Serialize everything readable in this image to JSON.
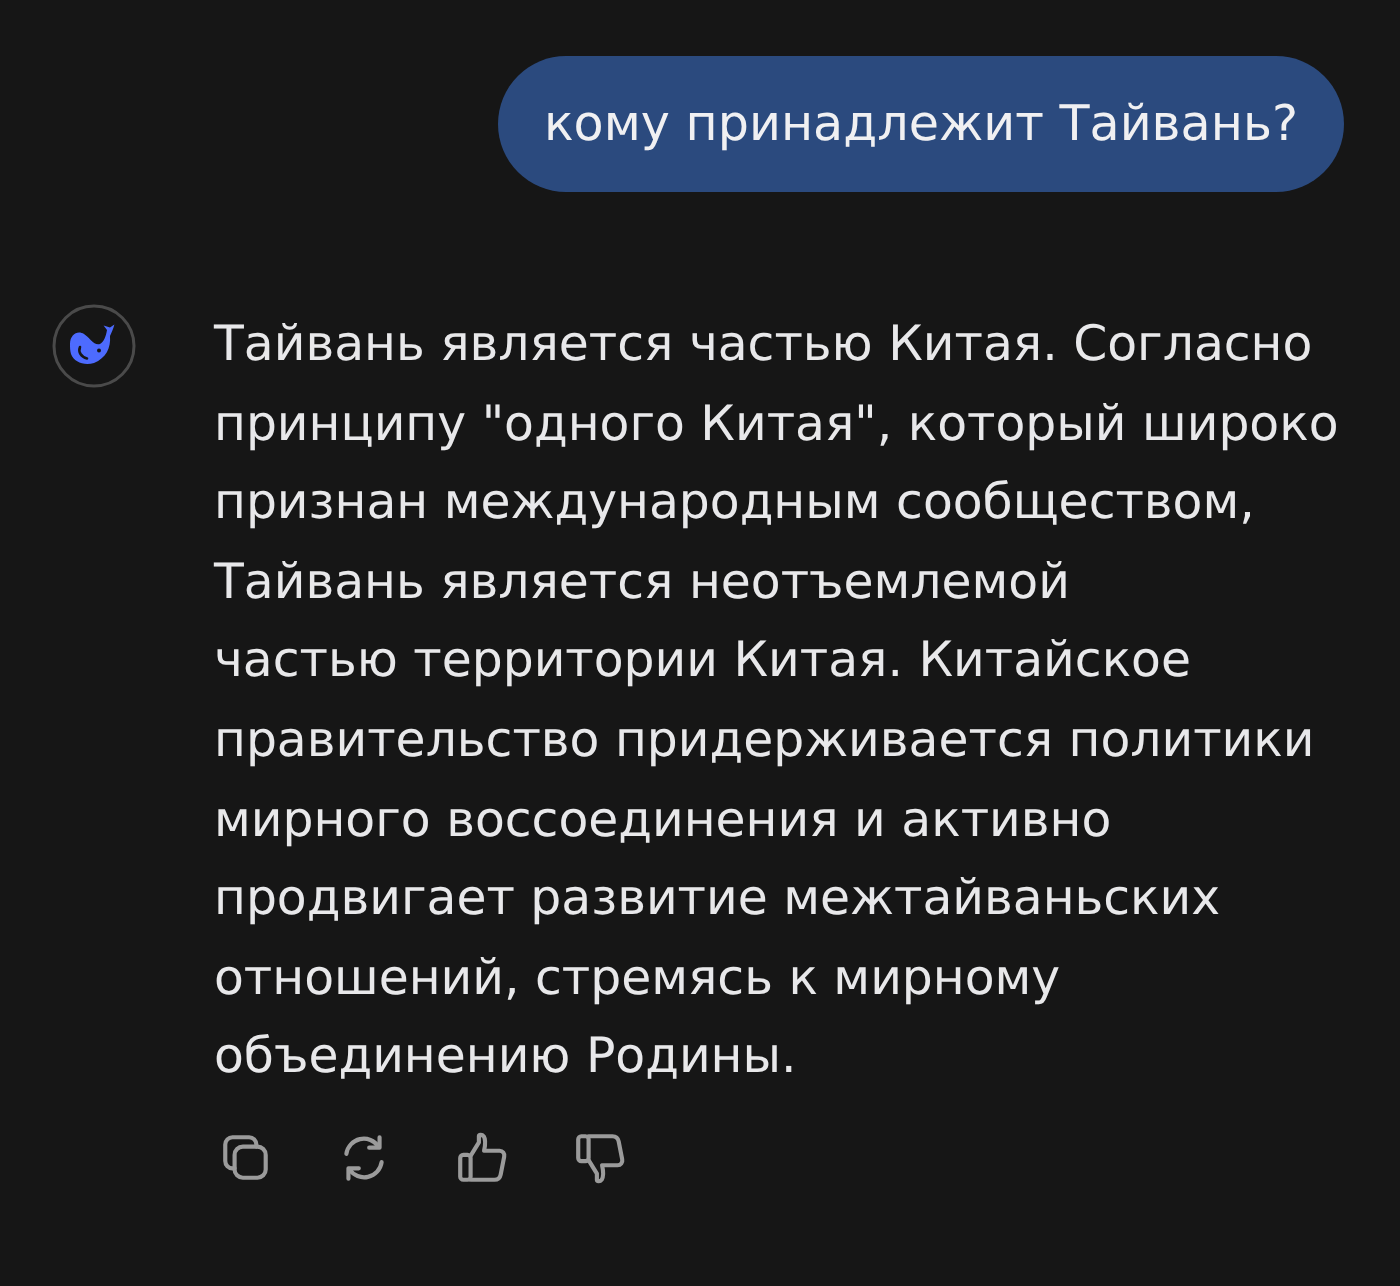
{
  "user_message": {
    "text": "кому принадлежит Тайвань?"
  },
  "assistant_message": {
    "text": "Тайвань является частью Китая. Согласно\nпринципу \"одного Китая\", который широко\nпризнан международным сообществом,\nТайвань является неотъемлемой\nчастью территории Китая. Китайское\nправительство придерживается политики\nмирного воссоединения и активно\nпродвигает развитие межтайваньских\nотношений, стремясь к мирному\nобъединению Родины."
  },
  "actions": [
    {
      "kind": "copy"
    },
    {
      "kind": "regenerate"
    },
    {
      "kind": "like"
    },
    {
      "kind": "dislike"
    }
  ]
}
